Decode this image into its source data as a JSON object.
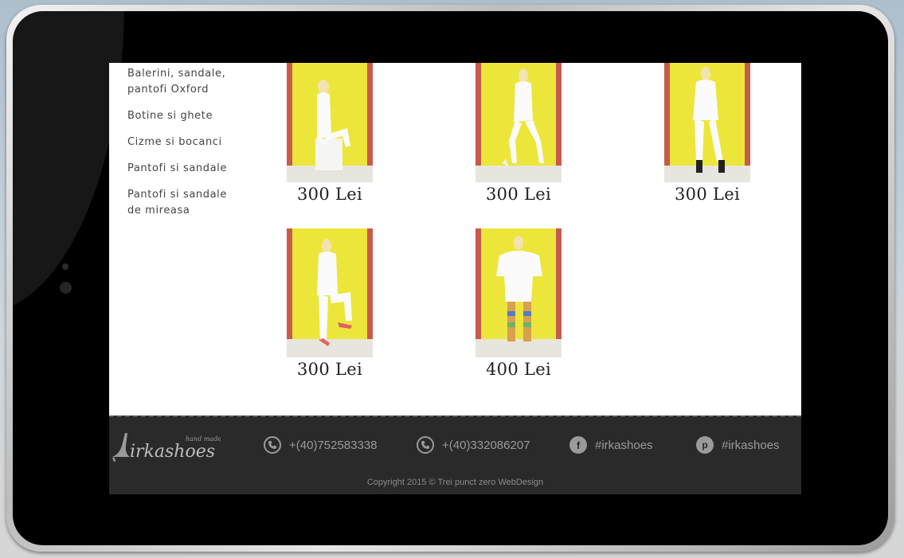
{
  "sidebar": {
    "categories": [
      {
        "label": "Balerini, sandale, pantofi Oxford"
      },
      {
        "label": "Botine si ghete"
      },
      {
        "label": "Cizme si bocanci"
      },
      {
        "label": "Pantofi si sandale"
      },
      {
        "label": "Pantofi si sandale de mireasa"
      }
    ]
  },
  "products": [
    {
      "price": "300 Lei"
    },
    {
      "price": "300 Lei"
    },
    {
      "price": "300 Lei"
    },
    {
      "price": "300 Lei"
    },
    {
      "price": "400 Lei"
    }
  ],
  "footer": {
    "logo_text": "irkashoes",
    "logo_tagline": "hand made",
    "phone_1": "+(40)752583338",
    "phone_2": "+(40)332086207",
    "facebook": "#irkashoes",
    "pinterest": "#irkashoes",
    "copyright": "Copyright 2015 © Trei punct zero WebDesign"
  },
  "colors": {
    "photo_background": "#ede63a",
    "photo_wall": "#c85a4c",
    "footer_background": "#2a2a2a",
    "footer_text": "#9a9a9a"
  },
  "icons": [
    "phone-icon",
    "facebook-icon",
    "pinterest-icon",
    "high-heel-logo-icon"
  ]
}
